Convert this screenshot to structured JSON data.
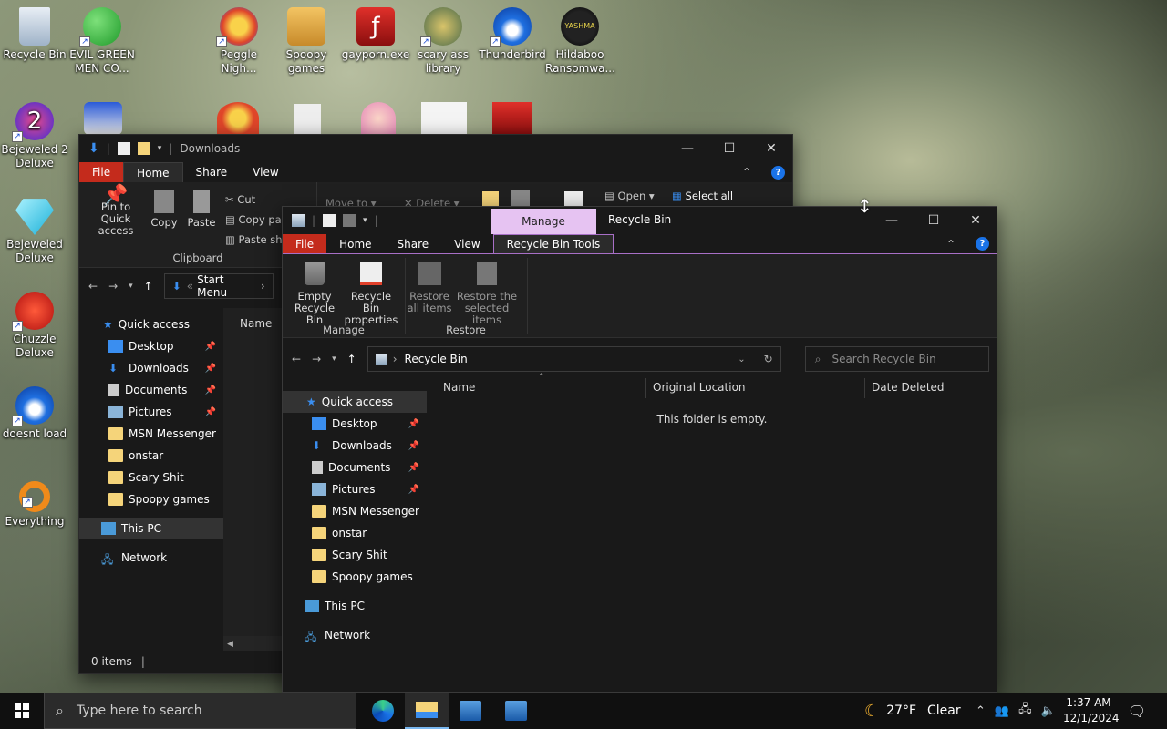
{
  "desktop": {
    "icons": [
      {
        "label": "Recycle Bin"
      },
      {
        "label": "EVIL GREEN MEN CO..."
      },
      {
        "label": "Peggle Nigh..."
      },
      {
        "label": "Spoopy games"
      },
      {
        "label": "gayporn.exe"
      },
      {
        "label": "scary ass library"
      },
      {
        "label": "Thunderbird"
      },
      {
        "label": "Hildaboo Ransomwa..."
      },
      {
        "label": "Bejeweled 2 Deluxe"
      },
      {
        "label": "Bejeweled Deluxe"
      },
      {
        "label": "Chuzzle Deluxe"
      },
      {
        "label": "doesnt load"
      },
      {
        "label": "Everything"
      }
    ]
  },
  "downloads_window": {
    "title": "Downloads",
    "tabs": [
      "File",
      "Home",
      "Share",
      "View"
    ],
    "ribbon": {
      "pin": "Pin to Quick access",
      "copy": "Copy",
      "paste": "Paste",
      "cut": "Cut",
      "copy_path": "Copy pa",
      "paste_shortcut": "Paste sh",
      "move_to": "Move to",
      "delete": "Delete",
      "open": "Open",
      "select_all": "Select all",
      "clipboard_group": "Clipboard"
    },
    "address": "Start Menu",
    "column_name": "Name",
    "nav": [
      {
        "label": "Quick access"
      },
      {
        "label": "Desktop"
      },
      {
        "label": "Downloads"
      },
      {
        "label": "Documents"
      },
      {
        "label": "Pictures"
      },
      {
        "label": "MSN Messenger"
      },
      {
        "label": "onstar"
      },
      {
        "label": "Scary Shit"
      },
      {
        "label": "Spoopy games"
      },
      {
        "label": "This PC"
      },
      {
        "label": "Network"
      }
    ],
    "status": "0 items"
  },
  "recycle_window": {
    "title": "Recycle Bin",
    "context_tab": "Manage",
    "tabs": [
      "File",
      "Home",
      "Share",
      "View",
      "Recycle Bin Tools"
    ],
    "ribbon": {
      "empty_line1": "Empty",
      "empty_line2": "Recycle Bin",
      "props_line1": "Recycle Bin",
      "props_line2": "properties",
      "restore_all_line1": "Restore",
      "restore_all_line2": "all items",
      "restore_sel_line1": "Restore the",
      "restore_sel_line2": "selected items",
      "group_manage": "Manage",
      "group_restore": "Restore"
    },
    "address": "Recycle Bin",
    "search_placeholder": "Search Recycle Bin",
    "columns": [
      "Name",
      "Original Location",
      "Date Deleted"
    ],
    "empty_message": "This folder is empty.",
    "nav": [
      {
        "label": "Quick access"
      },
      {
        "label": "Desktop"
      },
      {
        "label": "Downloads"
      },
      {
        "label": "Documents"
      },
      {
        "label": "Pictures"
      },
      {
        "label": "MSN Messenger"
      },
      {
        "label": "onstar"
      },
      {
        "label": "Scary Shit"
      },
      {
        "label": "Spoopy games"
      },
      {
        "label": "This PC"
      },
      {
        "label": "Network"
      }
    ]
  },
  "taskbar": {
    "search_placeholder": "Type here to search",
    "weather": "27°F",
    "weather_desc": "Clear",
    "time": "1:37 AM",
    "date": "12/1/2024"
  },
  "colors": {
    "file_tab": "#c42b1c",
    "manage_tab": "#e6c3f2",
    "accent": "#1a73e8"
  }
}
